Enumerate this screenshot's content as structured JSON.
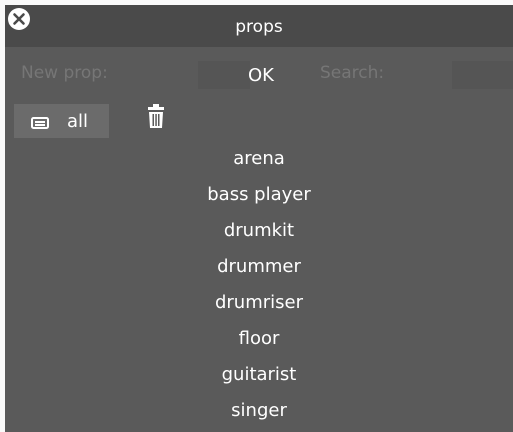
{
  "window": {
    "title": "props",
    "close_icon": "close-circle-icon"
  },
  "toolbar": {
    "new_prop_label": "New prop:",
    "new_prop_value": "",
    "ok_label": "OK",
    "search_label": "Search:",
    "search_value": ""
  },
  "filter": {
    "all_label": "all",
    "all_icon": "layers-icon",
    "delete_icon": "trash-icon"
  },
  "props": [
    "arena",
    "bass player",
    "drumkit",
    "drummer",
    "drumriser",
    "floor",
    "guitarist",
    "singer"
  ],
  "colors": {
    "window_bg": "#5a5a5a",
    "titlebar_bg": "#4a4a4a",
    "muted_text": "#767676",
    "text": "#ffffff",
    "button_bg": "#6b6b6b"
  }
}
